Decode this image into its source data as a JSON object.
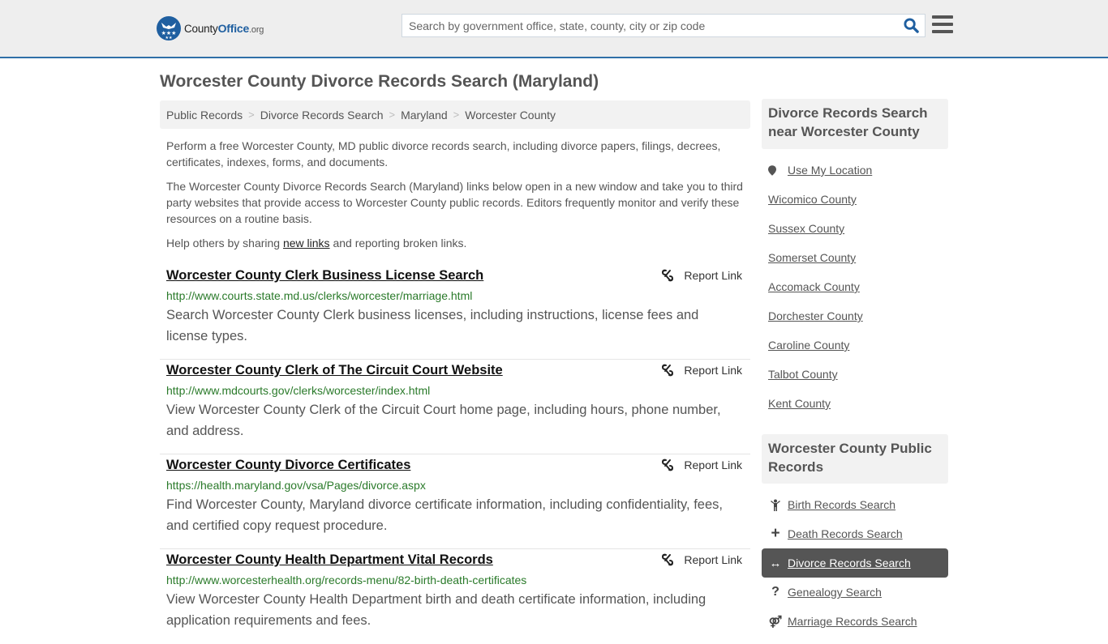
{
  "header": {
    "logo": {
      "brand_prefix": "County",
      "brand_main": "Office",
      "brand_suffix": ".org"
    },
    "search": {
      "placeholder": "Search by government office, state, county, city or zip code",
      "value": ""
    },
    "icons": {
      "search": "search-icon",
      "menu": "hamburger-menu-icon"
    }
  },
  "page": {
    "title": "Worcester County Divorce Records Search (Maryland)",
    "breadcrumb": [
      "Public Records",
      "Divorce Records Search",
      "Maryland",
      "Worcester County"
    ],
    "intro": {
      "p1": "Perform a free Worcester County, MD public divorce records search, including divorce papers, filings, decrees, certificates, indexes, forms, and documents.",
      "p2": "The Worcester County Divorce Records Search (Maryland) links below open in a new window and take you to third party websites that provide access to Worcester County public records. Editors frequently monitor and verify these resources on a routine basis.",
      "p3_before": "Help others by sharing ",
      "p3_link": "new links",
      "p3_after": " and reporting broken links."
    }
  },
  "results": [
    {
      "title": "Worcester County Clerk Business License Search",
      "url": "http://www.courts.state.md.us/clerks/worcester/marriage.html",
      "description": "Search Worcester County Clerk business licenses, including instructions, license fees and license types.",
      "report_label": "Report Link"
    },
    {
      "title": "Worcester County Clerk of The Circuit Court Website",
      "url": "http://www.mdcourts.gov/clerks/worcester/index.html",
      "description": "View Worcester County Clerk of the Circuit Court home page, including hours, phone number, and address.",
      "report_label": "Report Link"
    },
    {
      "title": "Worcester County Divorce Certificates",
      "url": "https://health.maryland.gov/vsa/Pages/divorce.aspx",
      "description": "Find Worcester County, Maryland divorce certificate information, including confidentiality, fees, and certified copy request procedure.",
      "report_label": "Report Link"
    },
    {
      "title": "Worcester County Health Department Vital Records",
      "url": "http://www.worcesterhealth.org/records-menu/82-birth-death-certificates",
      "description": "View Worcester County Health Department birth and death certificate information, including application requirements and fees.",
      "report_label": "Report Link"
    }
  ],
  "sidebar": {
    "nearby": {
      "heading": "Divorce Records Search near Worcester County",
      "use_location": "Use My Location",
      "counties": [
        "Wicomico County",
        "Sussex County",
        "Somerset County",
        "Accomack County",
        "Dorchester County",
        "Caroline County",
        "Talbot County",
        "Kent County"
      ]
    },
    "public_records": {
      "heading": "Worcester County Public Records",
      "items": [
        {
          "label": "Birth Records Search",
          "icon": "child-icon",
          "active": false
        },
        {
          "label": "Death Records Search",
          "icon": "plus-icon",
          "active": false
        },
        {
          "label": "Divorce Records Search",
          "icon": "arrows-horizontal-icon",
          "active": true
        },
        {
          "label": "Genealogy Search",
          "icon": "question-icon",
          "active": false
        },
        {
          "label": "Marriage Records Search",
          "icon": "venus-mars-icon",
          "active": false
        }
      ]
    }
  },
  "colors": {
    "accent": "#1f5fa0",
    "url_green": "#2a7a2a",
    "active_bg": "#555555",
    "header_bg": "#eeeeee",
    "header_border": "#2f6fa7"
  }
}
